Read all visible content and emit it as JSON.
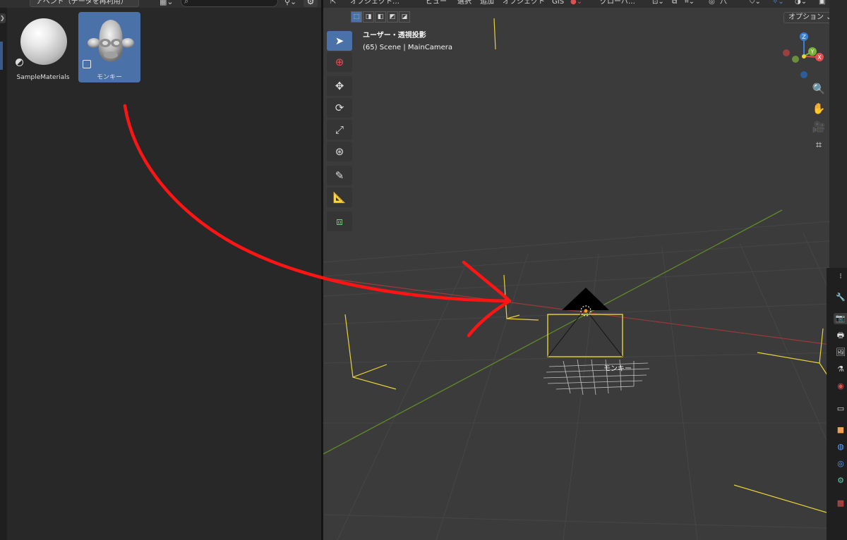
{
  "asset_browser": {
    "import_mode": "アペンド（データを再利用）",
    "search_placeholder": "",
    "assets": [
      {
        "name": "SampleMaterials",
        "type": "material"
      },
      {
        "name": "モンキー",
        "type": "object",
        "selected": true
      }
    ]
  },
  "viewport": {
    "header": {
      "editor_icon": "⇱",
      "mode": "オブジェクト…",
      "menus": [
        "ビュー",
        "選択",
        "追加",
        "オブジェクト",
        "GIS"
      ],
      "transform_orientation": "グローバ…",
      "pivot_label": "八"
    },
    "options_label": "オプション",
    "info": {
      "view_label": "ユーザー・透視投影",
      "scene_line": "(65) Scene | MainCamera"
    },
    "object_label": "モンキー",
    "gizmo": {
      "x": "X",
      "y": "Y",
      "z": "Z"
    },
    "colors": {
      "x_axis": "#e05050",
      "y_axis": "#7ab33a",
      "z_axis": "#3b7fd8",
      "selection": "#e8d23a",
      "annotation": "#ff1414",
      "active_blue": "#4a72a8"
    }
  }
}
